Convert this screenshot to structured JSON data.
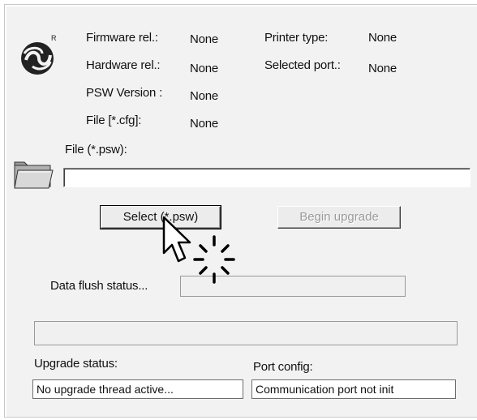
{
  "info": {
    "firmware_label": "Firmware rel.:",
    "firmware_value": "None",
    "hardware_label": "Hardware rel.:",
    "hardware_value": "None",
    "psw_label": "PSW Version :",
    "psw_value": "None",
    "cfg_label": "File [*.cfg]:",
    "cfg_value": "None",
    "printer_label": "Printer type:",
    "printer_value": "None",
    "port_label": "Selected port.:",
    "port_value": "None"
  },
  "file": {
    "label": "File (*.psw):",
    "value": ""
  },
  "buttons": {
    "select_label": "Select (*.psw)",
    "upgrade_label": "Begin upgrade"
  },
  "flush": {
    "label": "Data flush status...",
    "progress": 0
  },
  "upgrade": {
    "label": "Upgrade status:",
    "value": "No upgrade thread active..."
  },
  "port_config": {
    "label": "Port config:",
    "value": "Communication port not init"
  },
  "icons": {
    "logo": "brand-logo",
    "folder": "folder-icon",
    "cursor": "pointer-cursor-icon",
    "click": "click-burst-icon"
  }
}
